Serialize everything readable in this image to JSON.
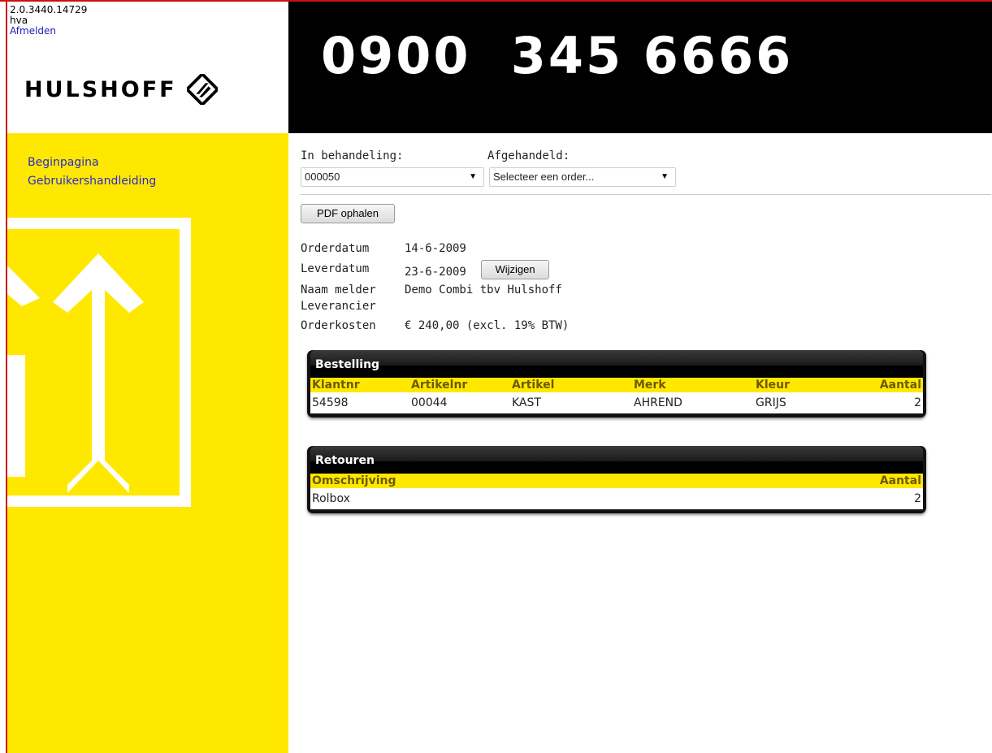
{
  "meta": {
    "version": "2.0.3440.14729",
    "user": "hva",
    "logout": "Afmelden"
  },
  "brand": {
    "logo_text": "HULSHOFF"
  },
  "banner": {
    "phone": "0900  345 6666"
  },
  "nav": {
    "items": [
      "Beginpagina",
      "Gebruikershandleiding"
    ]
  },
  "filters": {
    "in_behandeling": {
      "label": "In behandeling:",
      "value": "000050"
    },
    "afgehandeld": {
      "label": "Afgehandeld:",
      "value": "Selecteer een order..."
    }
  },
  "buttons": {
    "pdf": "PDF ophalen",
    "wijzigen": "Wijzigen"
  },
  "order": {
    "orderdatum_label": "Orderdatum",
    "orderdatum": "14-6-2009",
    "leverdatum_label": "Leverdatum",
    "leverdatum": "23-6-2009",
    "naam_melder_label": "Naam melder",
    "naam_melder": "Demo Combi tbv Hulshoff",
    "leverancier_label": "Leverancier",
    "leverancier": "",
    "orderkosten_label": "Orderkosten",
    "orderkosten": "€ 240,00 (excl. 19% BTW)"
  },
  "bestelling": {
    "title": "Bestelling",
    "columns": [
      "Klantnr",
      "Artikelnr",
      "Artikel",
      "Merk",
      "Kleur",
      "Aantal"
    ],
    "rows": [
      [
        "54598",
        "00044",
        "KAST",
        "AHREND",
        "GRIJS",
        "2"
      ]
    ]
  },
  "retouren": {
    "title": "Retouren",
    "columns": [
      "Omschrijving",
      "Aantal"
    ],
    "rows": [
      [
        "Rolbox",
        "2"
      ]
    ]
  },
  "colors": {
    "brand_yellow": "#ffe800",
    "banner_black": "#000000",
    "frame_red": "#cc1111",
    "link_blue": "#2a2ad0"
  }
}
